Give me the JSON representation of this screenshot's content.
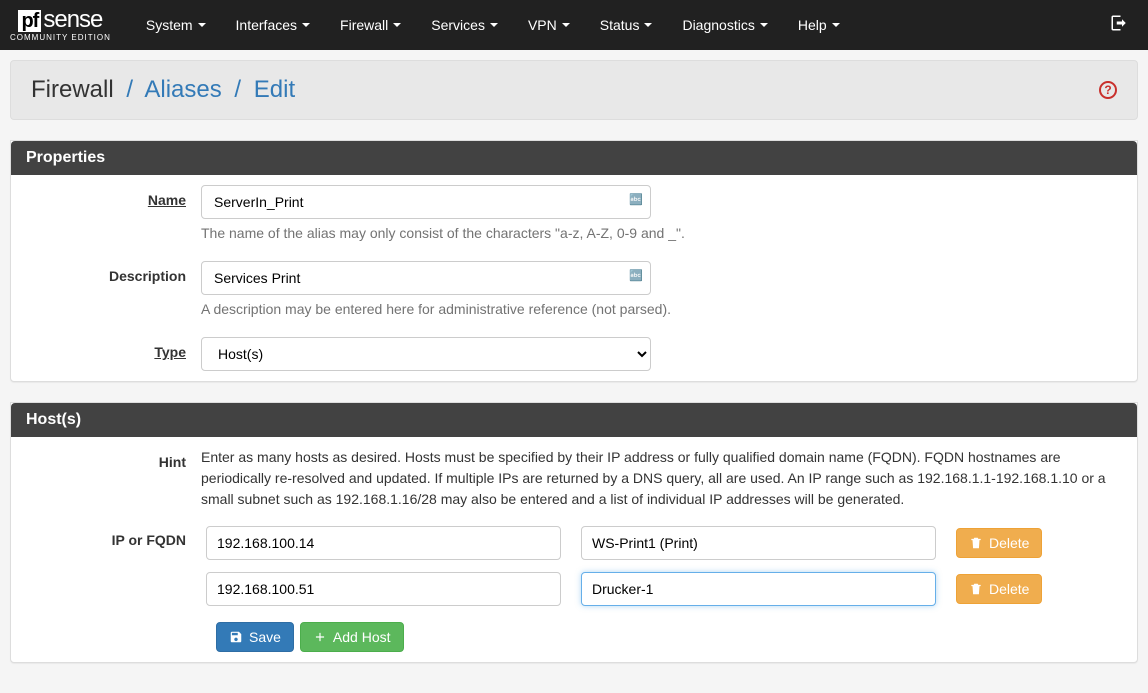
{
  "brand": {
    "prefix": "pf",
    "suffix": "sense",
    "subtitle": "COMMUNITY EDITION"
  },
  "nav": [
    "System",
    "Interfaces",
    "Firewall",
    "Services",
    "VPN",
    "Status",
    "Diagnostics",
    "Help"
  ],
  "breadcrumb": {
    "root": "Firewall",
    "mid": "Aliases",
    "leaf": "Edit"
  },
  "panels": {
    "properties": {
      "title": "Properties",
      "name_label": "Name",
      "name_value": "ServerIn_Print",
      "name_help": "The name of the alias may only consist of the characters \"a-z, A-Z, 0-9 and _\".",
      "desc_label": "Description",
      "desc_value": "Services Print",
      "desc_help": "A description may be entered here for administrative reference (not parsed).",
      "type_label": "Type",
      "type_value": "Host(s)"
    },
    "hosts": {
      "title": "Host(s)",
      "hint_label": "Hint",
      "hint_text": "Enter as many hosts as desired. Hosts must be specified by their IP address or fully qualified domain name (FQDN). FQDN hostnames are periodically re-resolved and updated. If multiple IPs are returned by a DNS query, all are used. An IP range such as 192.168.1.1-192.168.1.10 or a small subnet such as 192.168.1.16/28 may also be entered and a list of individual IP addresses will be generated.",
      "ip_label": "IP or FQDN",
      "rows": [
        {
          "ip": "192.168.100.14",
          "desc": "WS-Print1 (Print)"
        },
        {
          "ip": "192.168.100.51",
          "desc": "Drucker-1"
        }
      ],
      "delete_label": "Delete"
    }
  },
  "buttons": {
    "save": "Save",
    "add": "Add Host"
  }
}
